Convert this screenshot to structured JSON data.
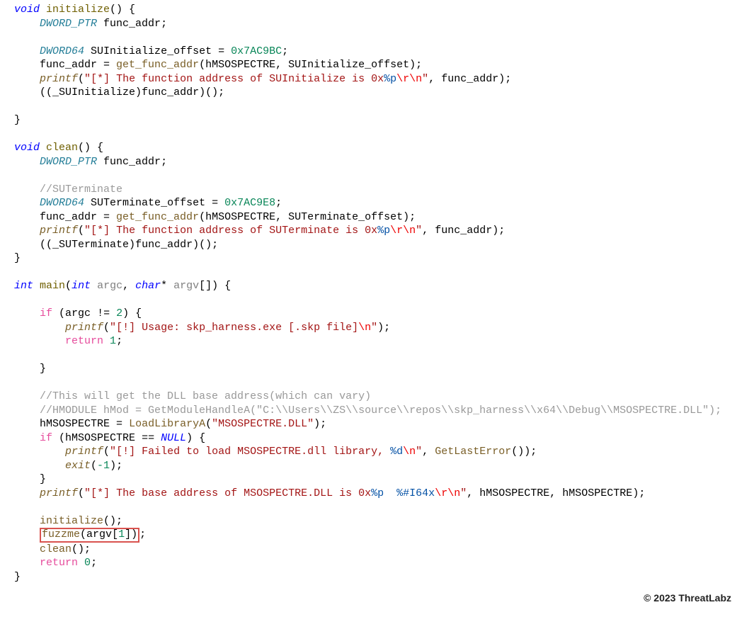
{
  "code": {
    "fn_initialize": {
      "signature": {
        "ret": "void",
        "name": "initialize"
      },
      "decl1_type": "DWORD_PTR",
      "decl1_var": "func_addr",
      "decl2_type": "DWORD64",
      "decl2_var": "SUInitialize_offset",
      "decl2_val": "0x7AC9BC",
      "assign_func": "get_func_addr",
      "assign_args": "hMSOSPECTRE, SUInitialize_offset",
      "printf_str": "[*] The function address of SUInitialize is 0x",
      "printf_fmt": "%p",
      "printf_esc": "\\r\\n",
      "printf_arg": "func_addr",
      "call_cast": "_SUInitialize",
      "call_var": "func_addr"
    },
    "fn_clean": {
      "signature": {
        "ret": "void",
        "name": "clean"
      },
      "decl1_type": "DWORD_PTR",
      "decl1_var": "func_addr",
      "comment": "//SUTerminate",
      "decl2_type": "DWORD64",
      "decl2_var": "SUTerminate_offset",
      "decl2_val": "0x7AC9E8",
      "assign_func": "get_func_addr",
      "assign_args": "hMSOSPECTRE, SUTerminate_offset",
      "printf_str": "[*] The function address of SUTerminate is 0x",
      "printf_fmt": "%p",
      "printf_esc": "\\r\\n",
      "printf_arg": "func_addr",
      "call_cast": "_SUTerminate",
      "call_var": "func_addr"
    },
    "fn_main": {
      "signature": {
        "ret": "int",
        "name": "main",
        "p1_type": "int",
        "p1_name": "argc",
        "p2_type": "char",
        "p2_name": "argv"
      },
      "if_cond_var": "argc",
      "if_cond_val": "2",
      "usage_str": "[!] Usage: skp_harness.exe [.skp file]",
      "usage_esc": "\\n",
      "ret1": "1",
      "comment1": "//This will get the DLL base address(which can vary)",
      "comment2": "//HMODULE hMod = GetModuleHandleA(\"C:\\\\Users\\\\ZS\\\\source\\\\repos\\\\skp_harness\\\\x64\\\\Debug\\\\MSOSPECTRE.DLL\");",
      "load_var": "hMSOSPECTRE",
      "load_func": "LoadLibraryA",
      "load_arg": "MSOSPECTRE.DLL",
      "if2_var": "hMSOSPECTRE",
      "if2_const": "NULL",
      "fail_str": "[!] Failed to load MSOSPECTRE.dll library, ",
      "fail_fmt": "%d",
      "fail_esc": "\\n",
      "fail_func": "GetLastError",
      "exit_func": "exit",
      "exit_arg": "-1",
      "base_str": "[*] The base address of MSOSPECTRE.DLL is 0x",
      "base_fmt1": "%p",
      "base_mid": "  ",
      "base_fmt2": "%#I64x",
      "base_esc": "\\r\\n",
      "base_arg1": "hMSOSPECTRE",
      "base_arg2": "hMSOSPECTRE",
      "call_init": "initialize",
      "call_fuzz": "fuzzme",
      "fuzz_arg": "argv",
      "fuzz_idx": "1",
      "call_clean": "clean",
      "ret0": "0"
    }
  },
  "copyright": "© 2023 ThreatLabz"
}
